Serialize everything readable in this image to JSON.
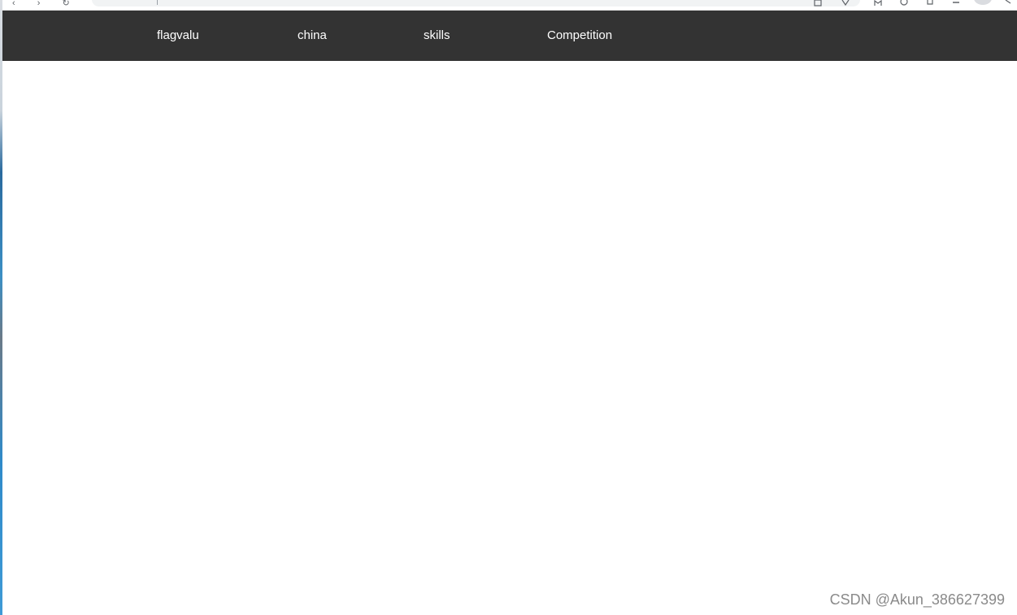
{
  "nav": {
    "items": [
      {
        "label": "flagvalu"
      },
      {
        "label": "china"
      },
      {
        "label": "skills"
      },
      {
        "label": "Competition"
      }
    ],
    "background_color": "#333333",
    "text_color": "#ffffff"
  },
  "watermark": {
    "text": "CSDN @Akun_386627399"
  }
}
